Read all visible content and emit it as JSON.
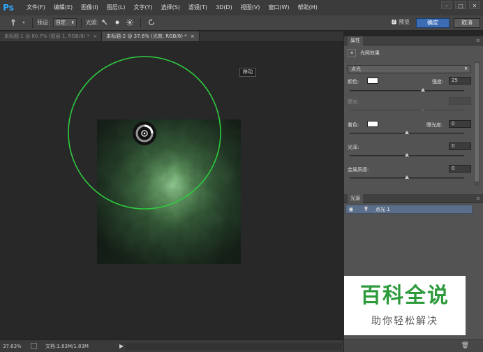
{
  "app": {
    "logo": "Ps"
  },
  "menu": [
    "文件(F)",
    "编辑(E)",
    "图像(I)",
    "图层(L)",
    "文字(Y)",
    "选择(S)",
    "滤镜(T)",
    "3D(D)",
    "视图(V)",
    "窗口(W)",
    "帮助(H)"
  ],
  "window_controls": {
    "minimize": "–",
    "restore": "□",
    "close": "✕"
  },
  "options": {
    "preset_label": "预设:",
    "preset_value": "自定",
    "light_label": "光照:",
    "preview_label": "预览",
    "preview_checked": true,
    "ok_label": "确定",
    "cancel_label": "取消"
  },
  "tabs": [
    {
      "label": "未标题-1 @ 80.7% (图层 1, RGB/8) *",
      "close": "×",
      "active": false
    },
    {
      "label": "未标题-2 @ 37.6% (光效, RGB/8) *",
      "close": "×",
      "active": true
    }
  ],
  "canvas": {
    "tooltip": "移动"
  },
  "status": {
    "zoom": "37.63%",
    "doc": "文档:1.83M/1.83M",
    "arrow": "▶"
  },
  "properties": {
    "panel_title": "属性",
    "effect_title": "光照效果",
    "light_type": "点光",
    "color_label": "颜色:",
    "intensity_label": "强度:",
    "intensity_value": "25",
    "hotspot_label": "聚光:",
    "colorize_label": "着色:",
    "exposure_label": "曝光度:",
    "exposure_value": "0",
    "gloss_label": "光泽:",
    "gloss_value": "0",
    "metallic_label": "金属质感:",
    "metallic_value": "0",
    "sliders": {
      "intensity": 0.64,
      "hotspot": 0.64,
      "exposure": 0.5,
      "gloss": 0.5,
      "metallic": 0.5
    }
  },
  "lights": {
    "panel_title": "光源",
    "items": [
      {
        "name": "点光 1"
      }
    ]
  },
  "watermark": {
    "big": "百科全说",
    "small": "助你轻松解决"
  },
  "colors": {
    "accent": "#3b6cb4",
    "light_ring": "#2ecc40",
    "selected_row": "#5c6f8a",
    "watermark_green": "#2d9b3b"
  }
}
